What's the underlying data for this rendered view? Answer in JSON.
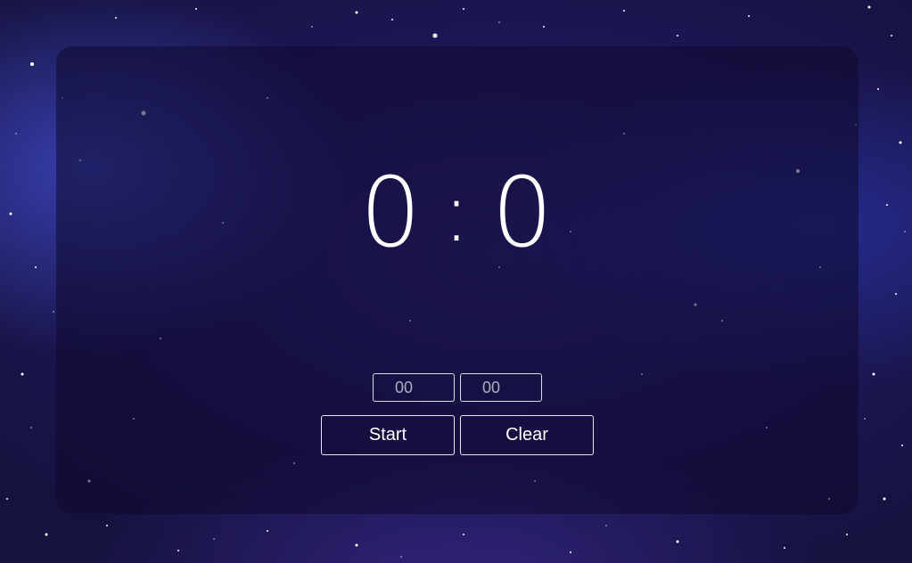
{
  "timer": {
    "minutes": "0",
    "separator": ":",
    "seconds": "0"
  },
  "inputs": {
    "minutes_placeholder": "00",
    "seconds_placeholder": "00"
  },
  "controls": {
    "start_label": "Start",
    "clear_label": "Clear"
  },
  "colors": {
    "background": "#1b1650",
    "panel": "#0e0a2d",
    "text": "#ffffff"
  }
}
